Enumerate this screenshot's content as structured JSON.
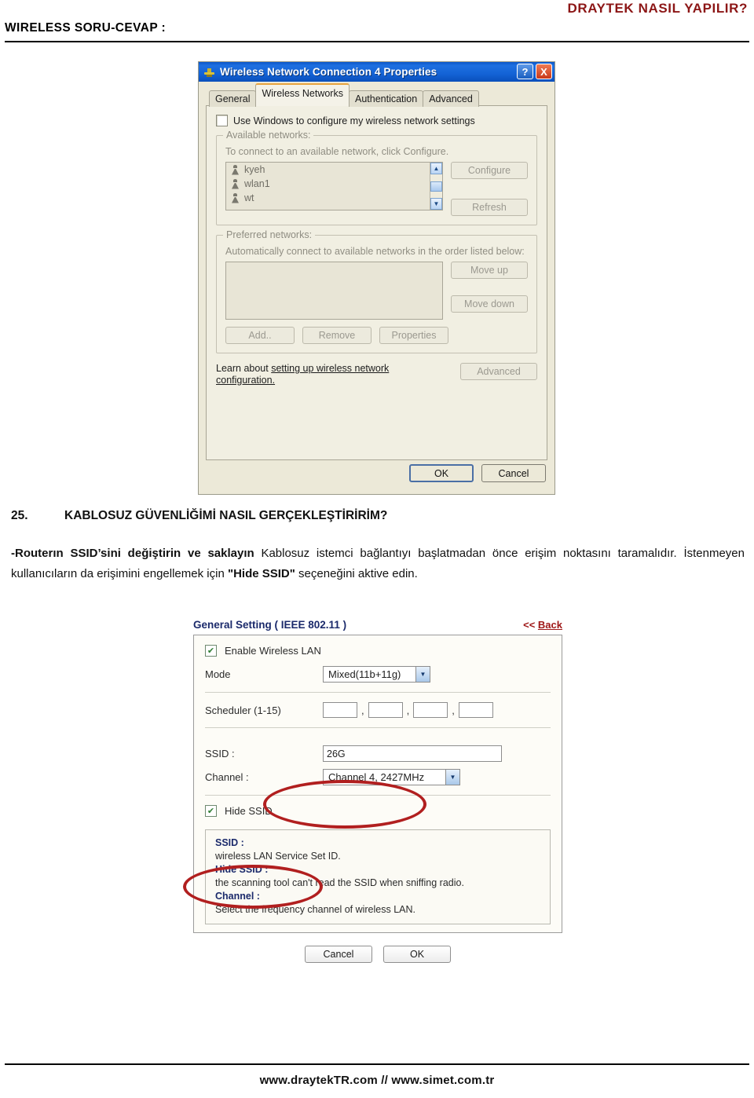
{
  "header": {
    "left_title": "WIRELESS SORU-CEVAP :",
    "right_title": "DRAYTEK NASIL YAPILIR?"
  },
  "xp_dialog": {
    "title": "Wireless Network Connection 4 Properties",
    "help_button": "?",
    "close_button": "X",
    "tabs": [
      {
        "label": "General"
      },
      {
        "label": "Wireless Networks"
      },
      {
        "label": "Authentication"
      },
      {
        "label": "Advanced"
      }
    ],
    "use_windows_checkbox": "Use Windows to configure my wireless network settings",
    "available": {
      "legend": "Available networks:",
      "hint": "To connect to an available network, click Configure.",
      "items": [
        {
          "name": "kyeh"
        },
        {
          "name": "wlan1"
        },
        {
          "name": "wt"
        }
      ],
      "configure_button": "Configure",
      "refresh_button": "Refresh"
    },
    "preferred": {
      "legend": "Preferred networks:",
      "hint": "Automatically connect to available networks in the order listed below:",
      "items": [],
      "move_up_button": "Move up",
      "move_down_button": "Move down",
      "add_button": "Add..",
      "remove_button": "Remove",
      "properties_button": "Properties"
    },
    "learn_prefix": "Learn about ",
    "learn_link": "setting up wireless network configuration.",
    "advanced_button": "Advanced",
    "ok_button": "OK",
    "cancel_button": "Cancel"
  },
  "question": {
    "number": "25.",
    "title": "KABLOSUZ GÜVENLİĞİMİ NASIL GERÇEKLEŞTİRİRİM?",
    "body_bold_1": "-Routerın SSID’sini değiştirin ve saklayın",
    "body_text_1": " Kablosuz istemci bağlantıyı başlatmadan önce erişim noktasını taramalıdır. İstenmeyen kullanıcıların da erişimini engellemek için ",
    "body_bold_2": "\"Hide SSID\"",
    "body_text_2": " seçeneğini aktive edin."
  },
  "router_panel": {
    "title": "General Setting ( IEEE 802.11 )",
    "back_prefix": "<< ",
    "back_label": "Back",
    "enable_wireless_label": "Enable Wireless LAN",
    "enable_wireless_checked": true,
    "mode_label": "Mode",
    "mode_value": "Mixed(11b+11g)",
    "scheduler_label": "Scheduler (1-15)",
    "scheduler_values": [
      "",
      "",
      "",
      ""
    ],
    "scheduler_separator": ",",
    "ssid_label": "SSID :",
    "ssid_value": "26G",
    "channel_label": "Channel :",
    "channel_value": "Channel 4, 2427MHz",
    "hide_ssid_label": "Hide SSID",
    "hide_ssid_checked": true,
    "help": [
      {
        "term": "SSID :",
        "desc": "wireless LAN Service Set ID."
      },
      {
        "term": "Hide SSID :",
        "desc": "the scanning tool can't read the SSID when sniffing radio."
      },
      {
        "term": "Channel :",
        "desc": "Select the frequency channel of wireless LAN."
      }
    ],
    "cancel_button": "Cancel",
    "ok_button": "OK"
  },
  "footer": {
    "text": "www.draytekTR.com  //  www.simet.com.tr"
  },
  "colors": {
    "brand_red": "#8c1616",
    "router_navy": "#1b2a6b",
    "annotation_red": "#b11f1f",
    "xp_title_blue": "#0b57c9"
  }
}
